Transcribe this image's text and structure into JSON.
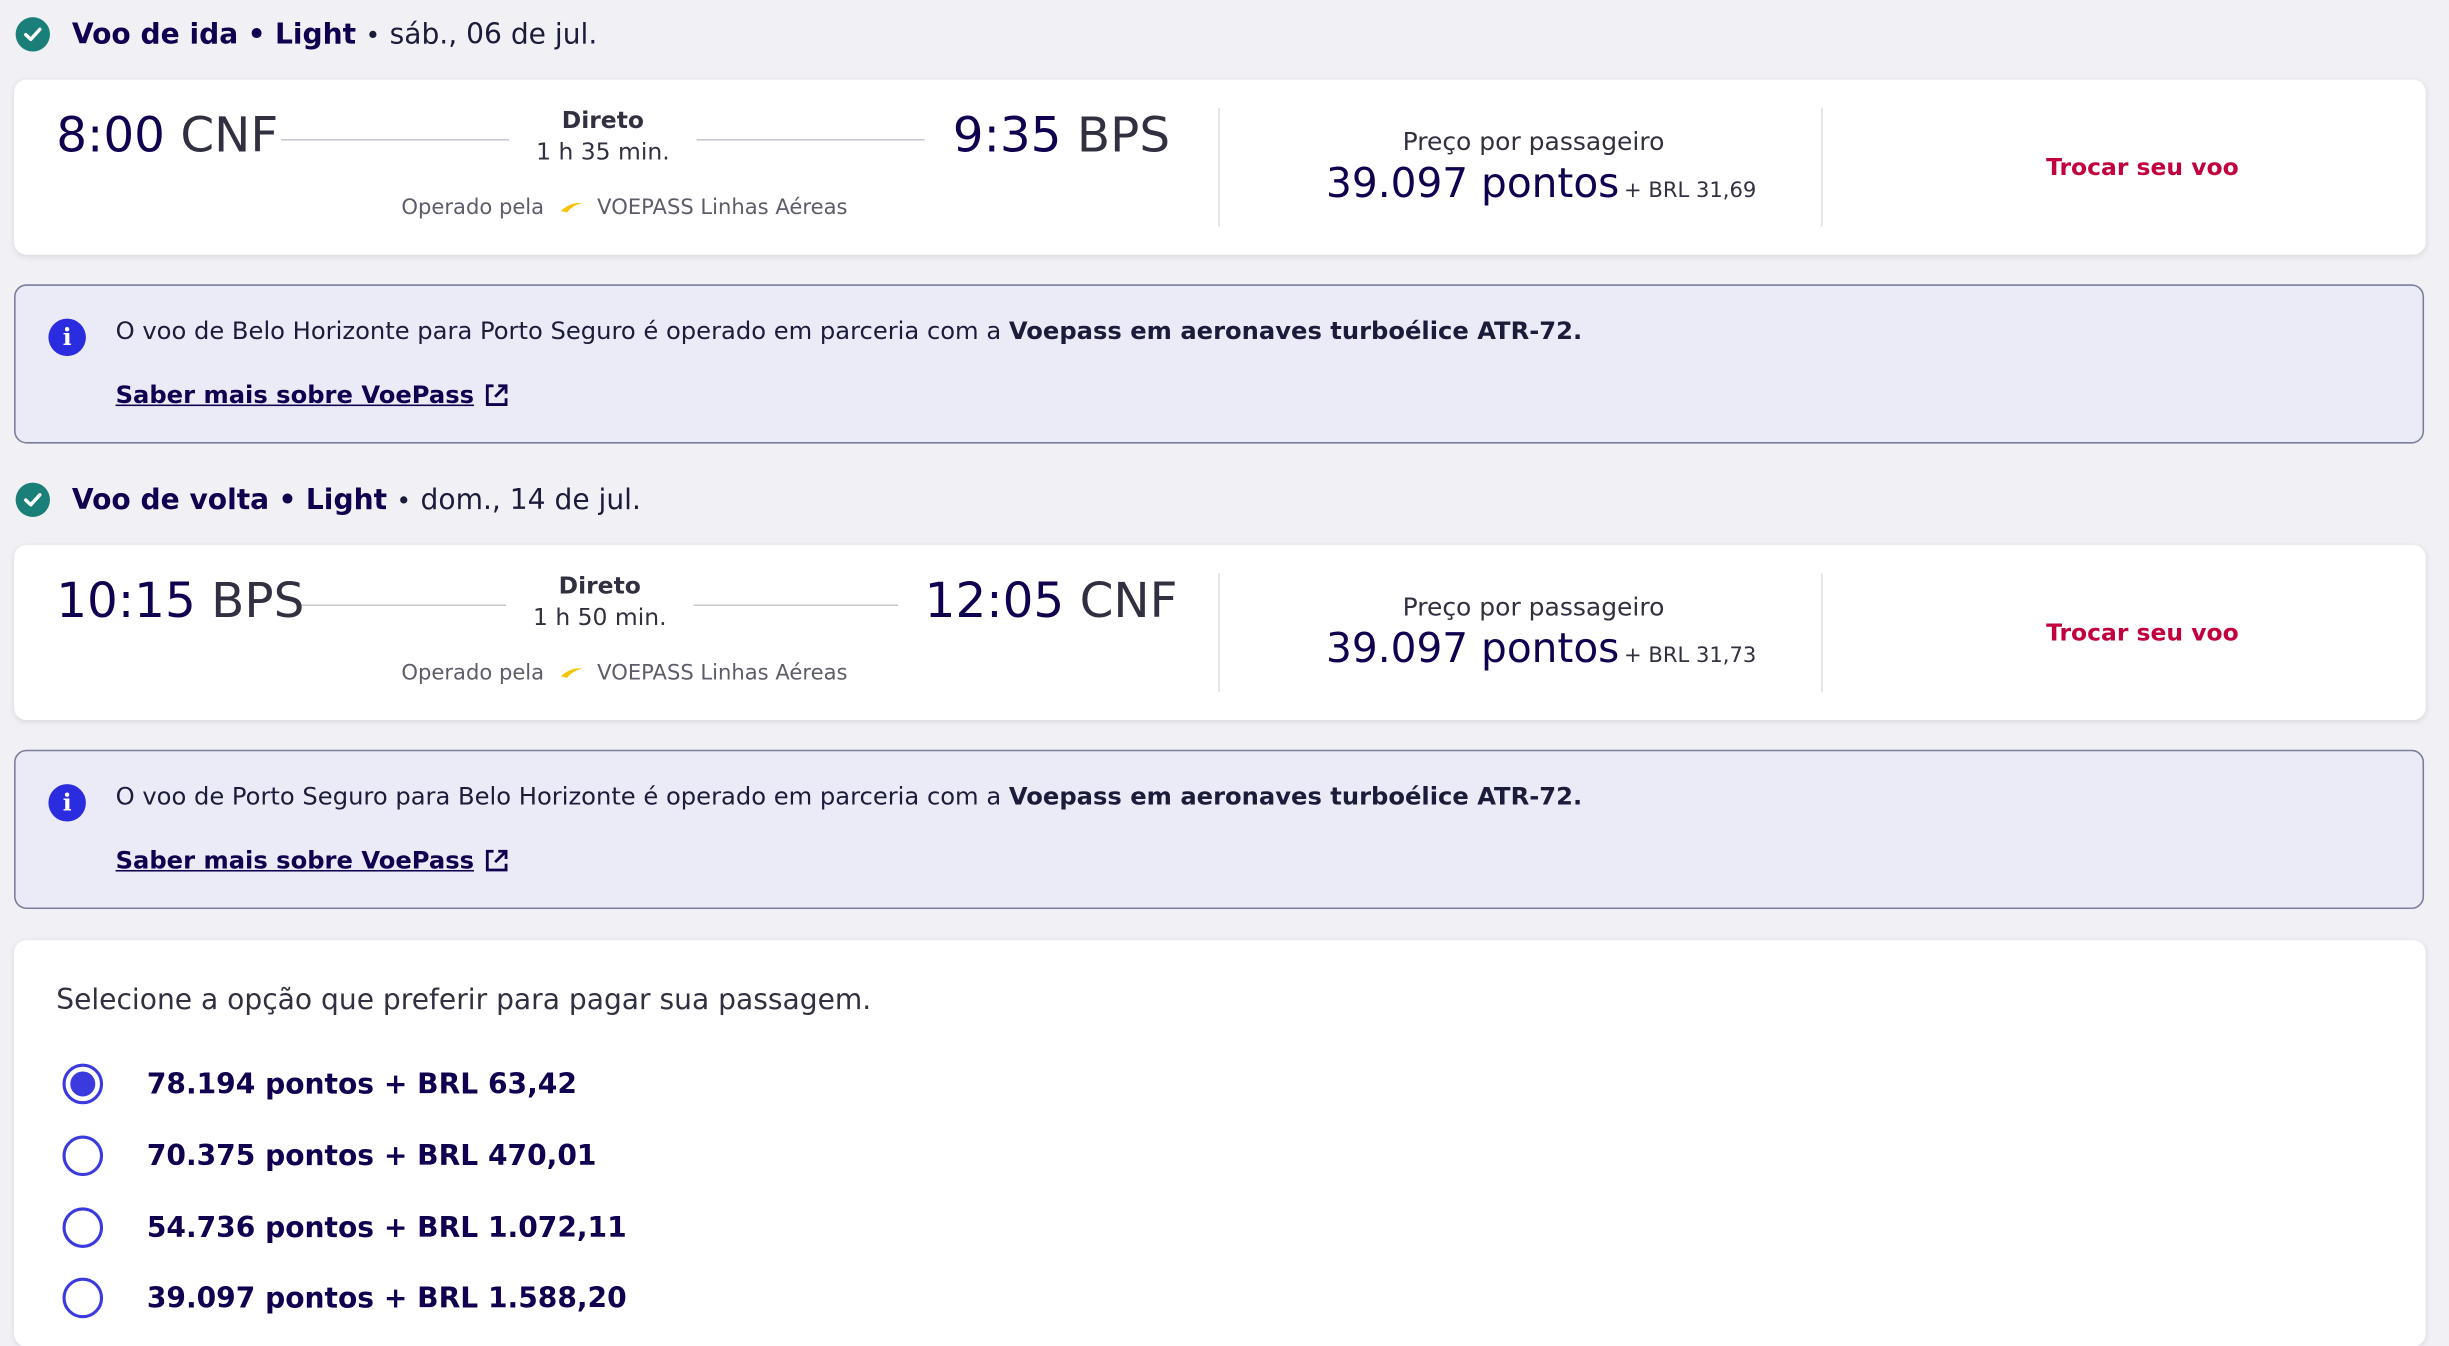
{
  "colors": {
    "accent": "#3a3adf",
    "brand_text": "#10004f",
    "change": "#c2003e",
    "check": "#1b7f79"
  },
  "outbound": {
    "heading": "Voo de ida",
    "fare": "Light",
    "date": "sáb., 06 de jul.",
    "dep_time": "8:00",
    "dep_code": "CNF",
    "stops": "Direto",
    "duration": "1 h 35 min.",
    "arr_time": "9:35",
    "arr_code": "BPS",
    "operated_by": "Operado pela",
    "operator": "VOEPASS Linhas Aéreas",
    "price_label": "Preço por passageiro",
    "points": "39.097 pontos",
    "brl": "+ BRL 31,69",
    "change_label": "Trocar seu voo"
  },
  "outbound_info": {
    "text": "O voo de Belo Horizonte para Porto Seguro é operado em parceria com a ",
    "bold": "Voepass em aeronaves turboélice ATR-72.",
    "link": "Saber mais sobre VoePass"
  },
  "inbound": {
    "heading": "Voo de volta",
    "fare": "Light",
    "date": "dom., 14 de jul.",
    "dep_time": "10:15",
    "dep_code": "BPS",
    "stops": "Direto",
    "duration": "1 h 50 min.",
    "arr_time": "12:05",
    "arr_code": "CNF",
    "operated_by": "Operado pela",
    "operator": "VOEPASS Linhas Aéreas",
    "price_label": "Preço por passageiro",
    "points": "39.097 pontos",
    "brl": "+ BRL 31,73",
    "change_label": "Trocar seu voo"
  },
  "inbound_info": {
    "text": "O voo de Porto Seguro para Belo Horizonte é operado em parceria com a ",
    "bold": "Voepass em aeronaves turboélice ATR-72.",
    "link": "Saber mais sobre VoePass"
  },
  "payment": {
    "title": "Selecione a opção que preferir para pagar sua passagem.",
    "options": [
      {
        "label": "78.194 pontos + BRL 63,42",
        "selected": true
      },
      {
        "label": "70.375 pontos + BRL 470,01",
        "selected": false
      },
      {
        "label": "54.736 pontos + BRL 1.072,11",
        "selected": false
      },
      {
        "label": "39.097 pontos + BRL 1.588,20",
        "selected": false
      }
    ]
  }
}
